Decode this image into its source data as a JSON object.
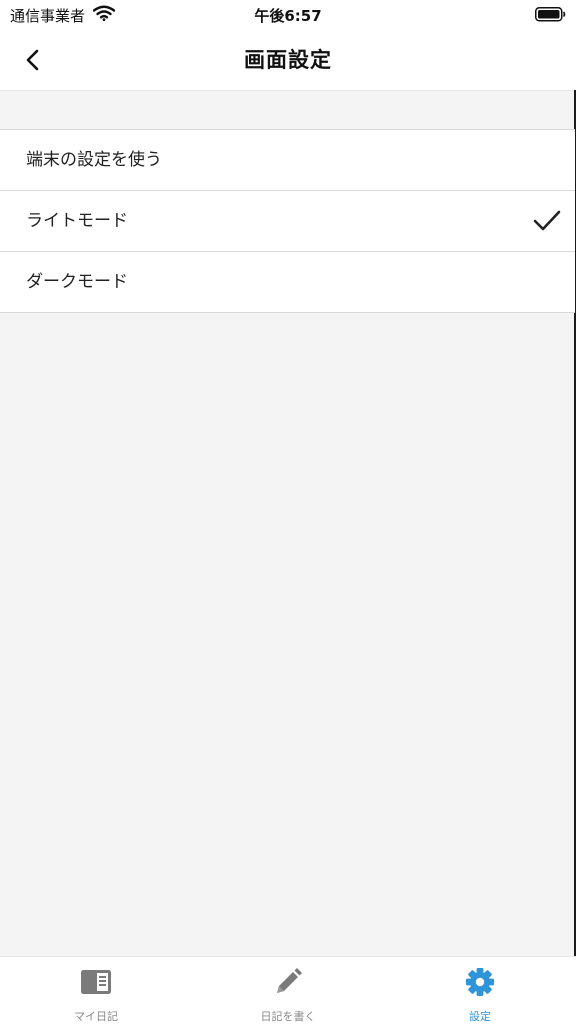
{
  "status_bar": {
    "carrier": "通信事業者",
    "time": "午後6:57",
    "icons": [
      "wifi-icon",
      "battery-icon"
    ]
  },
  "nav": {
    "title": "画面設定",
    "back_icon": "chevron-left-icon"
  },
  "options": [
    {
      "label": "端末の設定を使う",
      "selected": false
    },
    {
      "label": "ライトモード",
      "selected": true
    },
    {
      "label": "ダークモード",
      "selected": false
    }
  ],
  "tabs": [
    {
      "label": "マイ日記",
      "icon": "diary-book-icon",
      "active": false
    },
    {
      "label": "日記を書く",
      "icon": "pencil-icon",
      "active": false
    },
    {
      "label": "設定",
      "icon": "gear-icon",
      "active": true
    }
  ],
  "colors": {
    "accent": "#2f94d8",
    "inactive_tab": "#888888",
    "background": "#f4f4f4"
  }
}
